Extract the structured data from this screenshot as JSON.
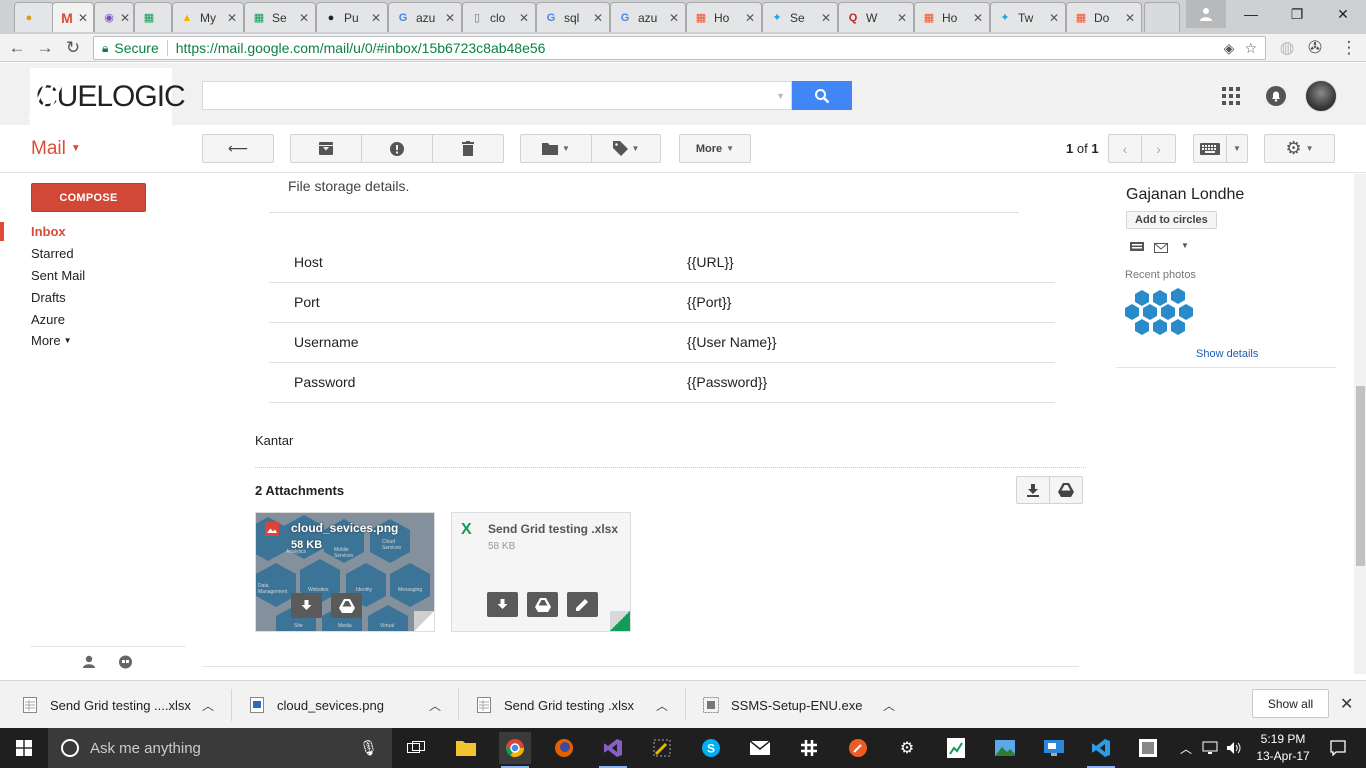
{
  "browser": {
    "tabs": [
      {
        "favicon": "chrome-icon",
        "title": "",
        "active": false
      },
      {
        "favicon": "gmail-icon",
        "title": "",
        "active": true
      },
      {
        "favicon": "chrome-icon",
        "title": "",
        "active": false
      },
      {
        "favicon": "sheets-icon",
        "title": "",
        "active": false
      },
      {
        "favicon": "drive-icon",
        "title": "My",
        "active": false
      },
      {
        "favicon": "sheets-icon",
        "title": "Se",
        "active": false
      },
      {
        "favicon": "github-icon",
        "title": "Pu",
        "active": false
      },
      {
        "favicon": "google-icon",
        "title": "azu",
        "active": false
      },
      {
        "favicon": "page-icon",
        "title": "clo",
        "active": false
      },
      {
        "favicon": "google-icon",
        "title": "sql",
        "active": false
      },
      {
        "favicon": "google-icon",
        "title": "azu",
        "active": false
      },
      {
        "favicon": "microsoft-icon",
        "title": "Ho",
        "active": false
      },
      {
        "favicon": "twitter-icon",
        "title": "Se",
        "active": false
      },
      {
        "favicon": "quora-icon",
        "title": "W",
        "active": false
      },
      {
        "favicon": "microsoft-icon",
        "title": "Ho",
        "active": false
      },
      {
        "favicon": "twitter-icon",
        "title": "Tw",
        "active": false
      },
      {
        "favicon": "microsoft-icon",
        "title": "Do",
        "active": false
      }
    ],
    "secure_label": "Secure",
    "url": "https://mail.google.com/mail/u/0/#inbox/15b6723c8ab48e56"
  },
  "header": {
    "logo_text": "CUELOGIC",
    "search_value": ""
  },
  "actionbar": {
    "mail_label": "Mail",
    "more_label": "More",
    "pager_current": "1",
    "pager_of": "of",
    "pager_total": "1"
  },
  "leftnav": {
    "compose": "COMPOSE",
    "items": [
      "Inbox",
      "Starred",
      "Sent Mail",
      "Drafts",
      "Azure"
    ],
    "more": "More"
  },
  "message": {
    "intro": "File storage details.",
    "rows": [
      {
        "key": "Host",
        "value": "{{URL}}"
      },
      {
        "key": "Port",
        "value": "{{Port}}"
      },
      {
        "key": "Username",
        "value": "{{User Name}}"
      },
      {
        "key": "Password",
        "value": "{{Password}}"
      }
    ],
    "signature": "Kantar"
  },
  "attachments": {
    "title": "2 Attachments",
    "files": [
      {
        "name": "cloud_sevices.png",
        "size": "58 KB"
      },
      {
        "name": "Send Grid testing .xlsx",
        "size": "58 KB"
      }
    ],
    "thumb_labels": [
      "Analytics",
      "Mobile Services",
      "Cloud Services",
      "Data Management",
      "Websites",
      "Identity",
      "Messaging",
      "Site",
      "Media",
      "Virtual"
    ]
  },
  "rightpanel": {
    "name": "Gajanan Londhe",
    "add_circles": "Add to circles",
    "recent_photos": "Recent photos",
    "show_details": "Show details"
  },
  "downloads": {
    "items": [
      {
        "name": "Send Grid testing ....xlsx",
        "icon": "xlsx-file-icon"
      },
      {
        "name": "cloud_sevices.png",
        "icon": "png-file-icon"
      },
      {
        "name": "Send Grid testing .xlsx",
        "icon": "xlsx-file-icon"
      },
      {
        "name": "SSMS-Setup-ENU.exe",
        "icon": "exe-file-icon"
      }
    ],
    "show_all": "Show all"
  },
  "taskbar": {
    "search_placeholder": "Ask me anything",
    "time": "5:19 PM",
    "date": "13-Apr-17"
  },
  "colors": {
    "gmail_red": "#dd4b39",
    "compose_red": "#d14836",
    "search_blue": "#4285f4",
    "link_blue": "#1a5fb4",
    "secure_green": "#0b8043"
  }
}
